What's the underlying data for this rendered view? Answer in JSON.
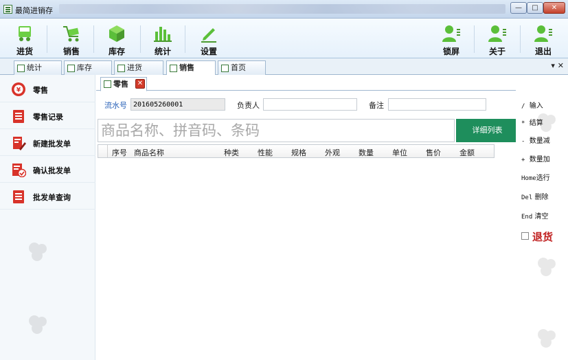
{
  "window": {
    "title": "最简进销存",
    "minimize": "—",
    "maximize": "□",
    "close": "✕"
  },
  "toolbar": {
    "left": [
      {
        "key": "jinhuo",
        "label": "进货"
      },
      {
        "key": "xiaoshou",
        "label": "销售"
      },
      {
        "key": "kucun",
        "label": "库存"
      },
      {
        "key": "tongji",
        "label": "统计"
      },
      {
        "key": "shezhi",
        "label": "设置"
      }
    ],
    "right": [
      {
        "key": "suoping",
        "label": "锁屏"
      },
      {
        "key": "guanyu",
        "label": "关于"
      },
      {
        "key": "tuichu",
        "label": "退出"
      }
    ]
  },
  "main_tabs": [
    {
      "label": "统计",
      "active": false
    },
    {
      "label": "库存",
      "active": false
    },
    {
      "label": "进货",
      "active": false
    },
    {
      "label": "销售",
      "active": true
    },
    {
      "label": "首页",
      "active": false
    }
  ],
  "tab_controls": "▾ ✕",
  "sidebar": {
    "items": [
      {
        "label": "零售",
        "icon": "yen-coin-icon"
      },
      {
        "label": "零售记录",
        "icon": "record-list-icon"
      },
      {
        "label": "新建批发单",
        "icon": "new-document-icon"
      },
      {
        "label": "确认批发单",
        "icon": "confirm-document-icon"
      },
      {
        "label": "批发单查询",
        "icon": "query-list-icon"
      }
    ]
  },
  "subtab": {
    "label": "零售",
    "close": "✕"
  },
  "form": {
    "serial_label": "流水号",
    "serial_value": "201605260001",
    "manager_label": "负责人",
    "manager_value": "",
    "remark_label": "备注",
    "remark_value": ""
  },
  "search": {
    "placeholder": "商品名称、拼音码、条码"
  },
  "detail_button": "详细列表",
  "grid": {
    "columns": [
      "序号",
      "商品名称",
      "种类",
      "性能",
      "规格",
      "外观",
      "数量",
      "单位",
      "售价",
      "金额"
    ]
  },
  "hotkeys": [
    {
      "key": "/",
      "desc": "输入"
    },
    {
      "key": "*",
      "desc": "结算"
    },
    {
      "key": "-",
      "desc": "数量减"
    },
    {
      "key": "+",
      "desc": "数量加"
    },
    {
      "key": "Home",
      "desc": "选行"
    },
    {
      "key": "Del",
      "desc": "删除"
    },
    {
      "key": "End",
      "desc": "清空"
    }
  ],
  "return_label": "退货",
  "colors": {
    "accent_green": "#1e8e5c",
    "icon_green": "#5bbf3a",
    "return_red": "#c02020",
    "sidebar_icon_red": "#d8332a"
  }
}
